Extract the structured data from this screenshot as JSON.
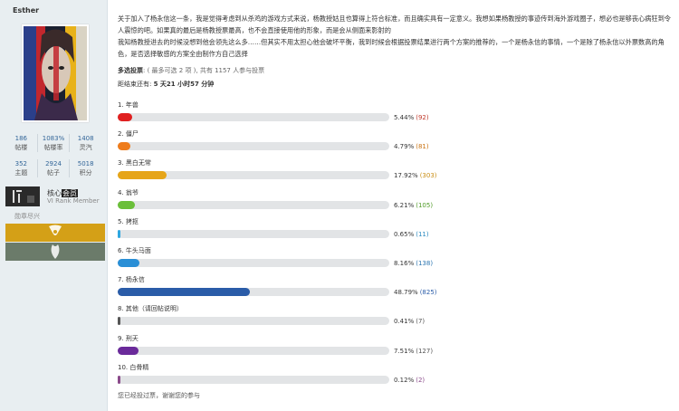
{
  "profile": {
    "username": "Esther",
    "stats_row1": [
      {
        "num": "186",
        "label": "帖楼"
      },
      {
        "num": "1083%",
        "label": "帖楼率"
      },
      {
        "num": "1408",
        "label": "灵汽"
      }
    ],
    "stats_row2": [
      {
        "num": "352",
        "label": "主题"
      },
      {
        "num": "2924",
        "label": "帖子"
      },
      {
        "num": "5018",
        "label": "积分"
      }
    ],
    "rank_prefix": "核心",
    "rank_badge": "会员",
    "rank_sub": "VI Rank Member",
    "medal_link": "勋章尽兴",
    "band_colors": [
      "#d4a017",
      "#6b7b6a"
    ]
  },
  "post": {
    "text": "关于加入了杨永信这一条，我是觉得考虑到从杀鸡的游戏方式来说，杨教授姑且也算得上符合标准，而且确实具有一定意义。我想如果杨教授的事迹传到海外游戏圈子，想必也是够丧心病狂到令人震惊的吧。如果真的最后是杨教授票最高，也不会直接使用他的形象，而是会从侧面来影射的\n我知杨教授进去的时候没想到他会领先这么多……但其实不用太担心他会破坏平衡，我到时候会根据投票结果进行两个方案的推荐的，一个是杨永信的事情，一个是除了杨永信以外票数高的角色，是否选择敏感的方案全由制作方自己选择"
  },
  "poll": {
    "type_label": "多选投票",
    "type_detail": ": ( 最多可选 2 项 ), 共有 1157 人参与投票",
    "countdown_label": "距结束还有: ",
    "countdown_value": "5 天21 小时57 分钟",
    "options": [
      {
        "label": "1.  年兽",
        "pct": 5.44,
        "pct_text": "5.44%",
        "count": "(92)",
        "color": "#e02020",
        "count_color": "#c0392b"
      },
      {
        "label": "2.  僵尸",
        "pct": 4.79,
        "pct_text": "4.79%",
        "count": "(81)",
        "color": "#ee7c1c",
        "count_color": "#c9710f"
      },
      {
        "label": "3.  黑白无常",
        "pct": 17.92,
        "pct_text": "17.92%",
        "count": "(303)",
        "color": "#e6a519",
        "count_color": "#c98e14"
      },
      {
        "label": "4.  翁爷",
        "pct": 6.21,
        "pct_text": "6.21%",
        "count": "(105)",
        "color": "#6bbf3a",
        "count_color": "#4f9a26"
      },
      {
        "label": "5.  拷抠",
        "pct": 0.65,
        "pct_text": "0.65%",
        "count": "(11)",
        "color": "#2ea7e0",
        "count_color": "#2a8ac0"
      },
      {
        "label": "6.  牛头马面",
        "pct": 8.16,
        "pct_text": "8.16%",
        "count": "(138)",
        "color": "#2a8fd6",
        "count_color": "#2a74b0"
      },
      {
        "label": "7.  杨永信",
        "pct": 48.79,
        "pct_text": "48.79%",
        "count": "(825)",
        "color": "#2a5ca8",
        "count_color": "#2a5ca8"
      },
      {
        "label": "8.  其他（请回帖说明）",
        "pct": 0.41,
        "pct_text": "0.41%",
        "count": "(7)",
        "color": "#555555",
        "count_color": "#555555"
      },
      {
        "label": "9.  刑天",
        "pct": 7.51,
        "pct_text": "7.51%",
        "count": "(127)",
        "color": "#6a2a9a",
        "count_color": "#555555"
      },
      {
        "label": "10.  白骨精",
        "pct": 0.12,
        "pct_text": "0.12%",
        "count": "(2)",
        "color": "#8a4a8a",
        "count_color": "#8a4a8a"
      }
    ],
    "footer_note": "您已经投过票，谢谢您的参与"
  }
}
